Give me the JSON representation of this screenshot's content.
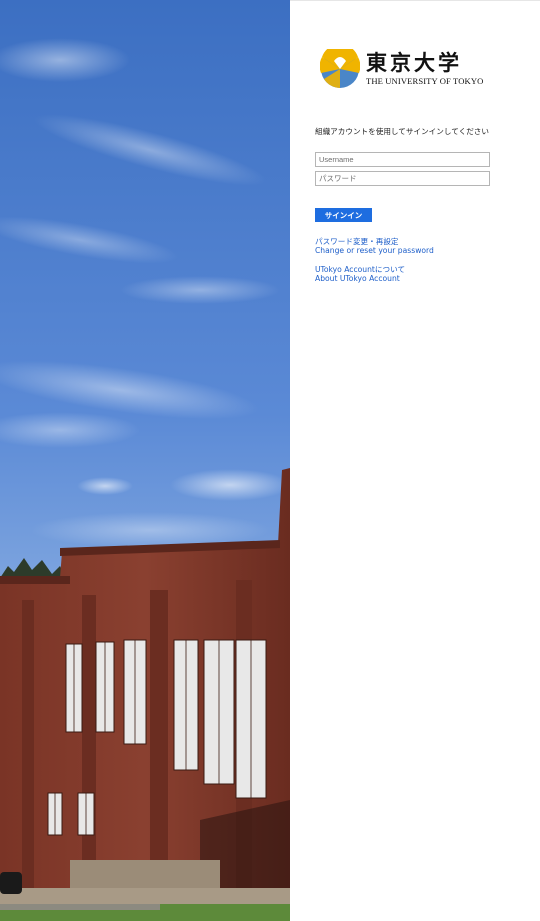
{
  "logo": {
    "jp": "東京大学",
    "en": "THE UNIVERSITY OF TOKYO"
  },
  "login": {
    "prompt": "組織アカウントを使用してサインインしてください",
    "username_placeholder": "Username",
    "password_placeholder": "パスワード",
    "signin_label": "サインイン"
  },
  "links": {
    "password_change_jp": "パスワード変更・再設定",
    "password_change_en": "Change or reset your password",
    "about_jp": "UTokyo Accountについて",
    "about_en": "About UTokyo Account"
  },
  "colors": {
    "accent": "#1e6de0",
    "link": "#1d5ec9",
    "logo_gold": "#f0b400",
    "logo_blue": "#4a86c8"
  }
}
